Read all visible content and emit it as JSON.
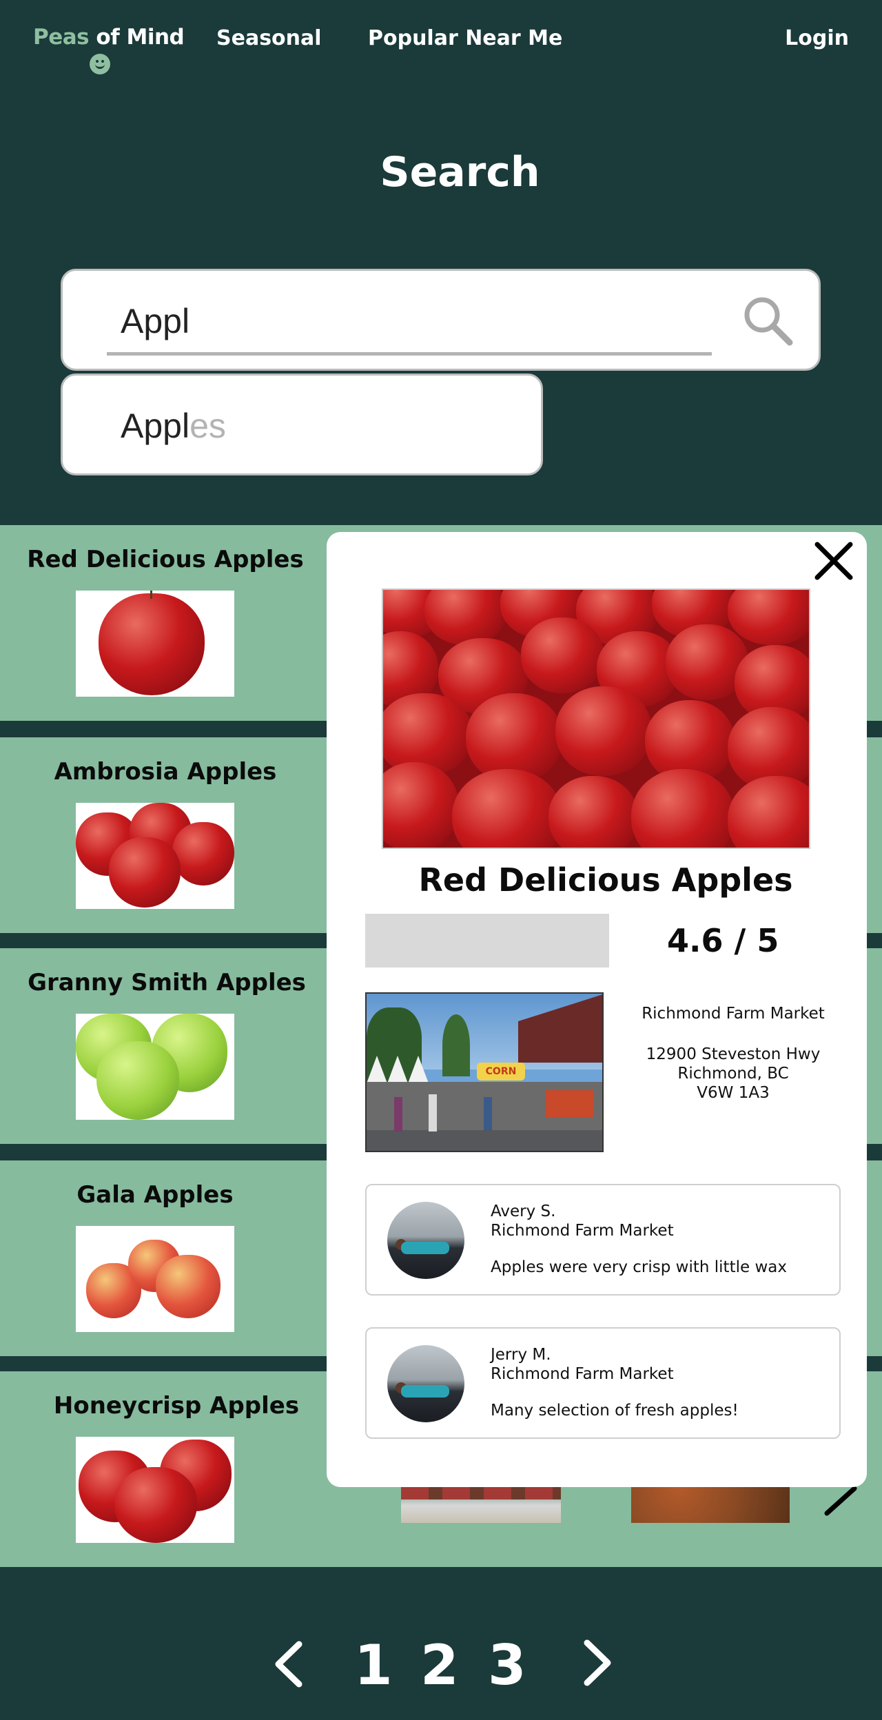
{
  "nav": {
    "logo_part1": "Peas",
    "logo_part2": " of Mind",
    "seasonal": "Seasonal",
    "popular": "Popular Near Me",
    "login": "Login"
  },
  "search": {
    "title": "Search",
    "value": "Appl",
    "suggestion_typed": "Appl",
    "suggestion_rest": "es"
  },
  "results": [
    {
      "name": "Red Delicious Apples"
    },
    {
      "name": "Ambrosia Apples"
    },
    {
      "name": "Granny Smith Apples"
    },
    {
      "name": "Gala Apples"
    },
    {
      "name": "Honeycrisp Apples"
    }
  ],
  "pagination": {
    "pages": [
      "1",
      "2",
      "3"
    ]
  },
  "modal": {
    "title": "Red Delicious Apples",
    "rating": "4.6 / 5",
    "market_name": "Richmond Farm Market",
    "address_line1": "12900 Steveston Hwy",
    "address_line2": "Richmond, BC",
    "address_line3": "V6W 1A3",
    "market_sign": "CORN",
    "reviews": [
      {
        "author": "Avery S.",
        "market": "Richmond Farm Market",
        "text": "Apples were very crisp with little wax"
      },
      {
        "author": "Jerry M.",
        "market": "Richmond Farm Market",
        "text": "Many selection of fresh apples!"
      }
    ]
  },
  "colors": {
    "background": "#1b3a3a",
    "row": "#86bb9e",
    "accent": "#8fbfa0",
    "modal": "#ffffff"
  }
}
